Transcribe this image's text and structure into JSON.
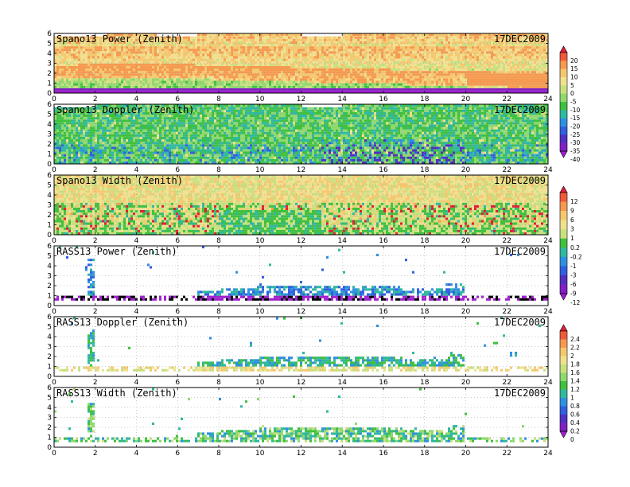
{
  "figure_date": "17DEC2009",
  "chart_data": [
    {
      "type": "heatmap",
      "title": "Spano13 Power (Zenith)",
      "date": "17DEC2009",
      "xlim": [
        0,
        24
      ],
      "ylim": [
        0,
        6
      ],
      "xticks": [
        "0",
        "2",
        "4",
        "6",
        "8",
        "10",
        "12",
        "14",
        "16",
        "18",
        "20",
        "22",
        "24"
      ],
      "yticks": [
        "0",
        "1",
        "2",
        "3",
        "4",
        "5",
        "6"
      ],
      "colorbar": "A",
      "fill": "full",
      "field": "power"
    },
    {
      "type": "heatmap",
      "title": "Spano13 Doppler (Zenith)",
      "date": "17DEC2009",
      "xlim": [
        0,
        24
      ],
      "ylim": [
        0,
        6
      ],
      "xticks": [
        "0",
        "2",
        "4",
        "6",
        "8",
        "10",
        "12",
        "14",
        "16",
        "18",
        "20",
        "22",
        "24"
      ],
      "yticks": [
        "0",
        "1",
        "2",
        "3",
        "4",
        "5",
        "6"
      ],
      "colorbar": "A",
      "fill": "full",
      "field": "doppler"
    },
    {
      "type": "heatmap",
      "title": "Spano13 Width (Zenith)",
      "date": "17DEC2009",
      "xlim": [
        0,
        24
      ],
      "ylim": [
        0,
        6
      ],
      "xticks": [
        "0",
        "2",
        "4",
        "6",
        "8",
        "10",
        "12",
        "14",
        "16",
        "18",
        "20",
        "22",
        "24"
      ],
      "yticks": [
        "0",
        "1",
        "2",
        "3",
        "4",
        "5",
        "6"
      ],
      "colorbar": "B",
      "fill": "full",
      "field": "width"
    },
    {
      "type": "heatmap",
      "title": "RASS13 Power (Zenith)",
      "date": "17DEC2009",
      "xlim": [
        0,
        24
      ],
      "ylim": [
        0,
        6
      ],
      "xticks": [
        "0",
        "2",
        "4",
        "6",
        "8",
        "10",
        "12",
        "14",
        "16",
        "18",
        "20",
        "22",
        "24"
      ],
      "yticks": [
        "0",
        "1",
        "2",
        "3",
        "4",
        "5",
        "6"
      ],
      "colorbar": "B",
      "fill": "sparse",
      "field": "rpower"
    },
    {
      "type": "heatmap",
      "title": "RASS13 Doppler (Zenith)",
      "date": "17DEC2009",
      "xlim": [
        0,
        24
      ],
      "ylim": [
        0,
        6
      ],
      "xticks": [
        "0",
        "2",
        "4",
        "6",
        "8",
        "10",
        "12",
        "14",
        "16",
        "18",
        "20",
        "22",
        "24"
      ],
      "yticks": [
        "0",
        "1",
        "2",
        "3",
        "4",
        "5",
        "6"
      ],
      "colorbar": "C",
      "fill": "sparse",
      "field": "rdoppler"
    },
    {
      "type": "heatmap",
      "title": "RASS13 Width (Zenith)",
      "date": "17DEC2009",
      "xlim": [
        0,
        24
      ],
      "ylim": [
        0,
        6
      ],
      "xticks": [
        "0",
        "2",
        "4",
        "6",
        "8",
        "10",
        "12",
        "14",
        "16",
        "18",
        "20",
        "22",
        "24"
      ],
      "yticks": [
        "0",
        "1",
        "2",
        "3",
        "4",
        "5",
        "6"
      ],
      "colorbar": "C",
      "fill": "sparse",
      "field": "rwidth"
    }
  ],
  "colorbars": {
    "A": {
      "labels": [
        "20",
        "15",
        "10",
        "5",
        "0",
        "-5",
        "-10",
        "-15",
        "-20",
        "-25",
        "-30",
        "-35",
        "-40"
      ],
      "colors": [
        "#e0203a",
        "#f05a3c",
        "#f59a50",
        "#f5c870",
        "#f0e090",
        "#c8e080",
        "#90d870",
        "#40c040",
        "#30b8a0",
        "#3090e0",
        "#3060e0",
        "#5030c0",
        "#8020c0",
        "#a020d0"
      ]
    },
    "B": {
      "labels": [
        "12",
        "9",
        "6",
        "3",
        "1",
        "0.2",
        "-0.2",
        "-1",
        "-3",
        "-6",
        "-9",
        "-12"
      ],
      "colors": [
        "#e0203a",
        "#f05a3c",
        "#f59a50",
        "#f5c870",
        "#f0e090",
        "#c8e080",
        "#40c040",
        "#30b8a0",
        "#3090e0",
        "#3060e0",
        "#5030c0",
        "#8020c0",
        "#a020d0"
      ]
    },
    "C": {
      "labels": [
        "2.4",
        "2.2",
        "2",
        "1.8",
        "1.6",
        "1.4",
        "1.2",
        "1",
        "0.8",
        "0.6",
        "0.4",
        "0.2",
        "0"
      ],
      "colors": [
        "#e0203a",
        "#f05a3c",
        "#f59a50",
        "#f5c870",
        "#f0e090",
        "#c8e080",
        "#90d870",
        "#40c040",
        "#30b8a0",
        "#3090e0",
        "#3060e0",
        "#5030c0",
        "#8020c0",
        "#a020d0"
      ]
    }
  }
}
